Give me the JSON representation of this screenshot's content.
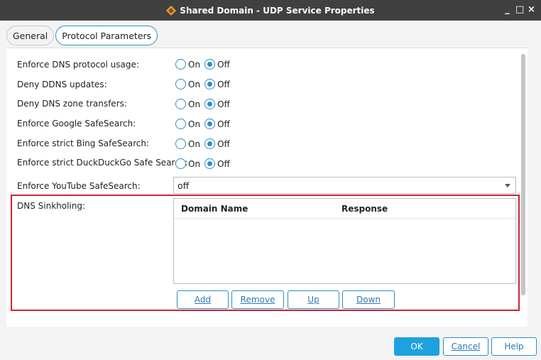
{
  "window": {
    "title": "Shared Domain - UDP Service Properties",
    "controls": [
      "_",
      "□",
      "×"
    ]
  },
  "tabs": [
    {
      "label": "General",
      "active": false
    },
    {
      "label": "Protocol Parameters",
      "active": true
    }
  ],
  "settings": [
    {
      "label": "Enforce DNS protocol usage:",
      "on_label": "On",
      "off_label": "Off",
      "value": "Off"
    },
    {
      "label": "Deny DDNS updates:",
      "on_label": "On",
      "off_label": "Off",
      "value": "Off"
    },
    {
      "label": "Deny DNS zone transfers:",
      "on_label": "On",
      "off_label": "Off",
      "value": "Off"
    },
    {
      "label": "Enforce Google SafeSearch:",
      "on_label": "On",
      "off_label": "Off",
      "value": "Off"
    },
    {
      "label": "Enforce strict Bing SafeSearch:",
      "on_label": "On",
      "off_label": "Off",
      "value": "Off"
    },
    {
      "label": "Enforce strict DuckDuckGo Safe Search:",
      "on_label": "On",
      "off_label": "Off",
      "value": "Off"
    }
  ],
  "youtube": {
    "label": "Enforce YouTube SafeSearch:",
    "value": "off"
  },
  "sinkholing": {
    "label": "DNS Sinkholing:",
    "columns": [
      "Domain Name",
      "Response"
    ],
    "rows": [],
    "buttons": {
      "add": "Add",
      "remove": "Remove",
      "up": "Up",
      "down": "Down"
    }
  },
  "footer": {
    "ok": "OK",
    "cancel": "Cancel",
    "help": "Help"
  },
  "colors": {
    "accent": "#2d8ec5",
    "highlight_frame": "#d1222f",
    "primary_button": "#1fa1e0",
    "titlebar": "#404040"
  }
}
